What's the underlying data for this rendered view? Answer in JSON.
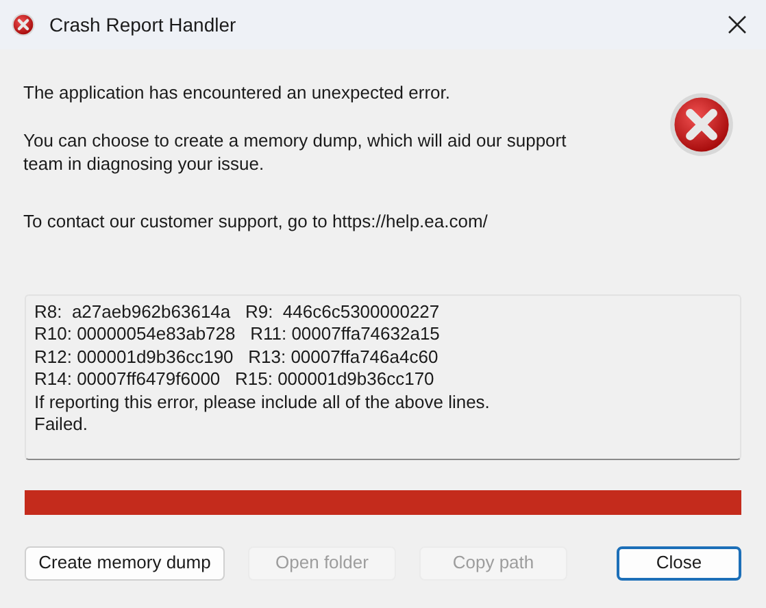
{
  "window": {
    "title": "Crash Report Handler"
  },
  "messages": [
    "The application has encountered an unexpected error.",
    "You can choose to create a memory dump, which will aid our support team in diagnosing your issue.",
    "To contact our customer support, go to https://help.ea.com/"
  ],
  "log": {
    "lines": [
      "R8:  a27aeb962b63614a   R9:  446c6c5300000227",
      "R10: 00000054e83ab728   R11: 00007ffa74632a15",
      "R12: 000001d9b36cc190   R13: 00007ffa746a4c60",
      "R14: 00007ff6479f6000   R15: 000001d9b36cc170",
      "If reporting this error, please include all of the above lines.",
      "Failed."
    ]
  },
  "progress": {
    "level": 1
  },
  "buttons": [
    {
      "label": "Create memory dump",
      "disabled": false,
      "default": false
    },
    {
      "label": "Open folder",
      "disabled": true,
      "default": false
    },
    {
      "label": "Copy path",
      "disabled": true,
      "default": false
    },
    {
      "label": "Close",
      "disabled": false,
      "default": true
    }
  ]
}
